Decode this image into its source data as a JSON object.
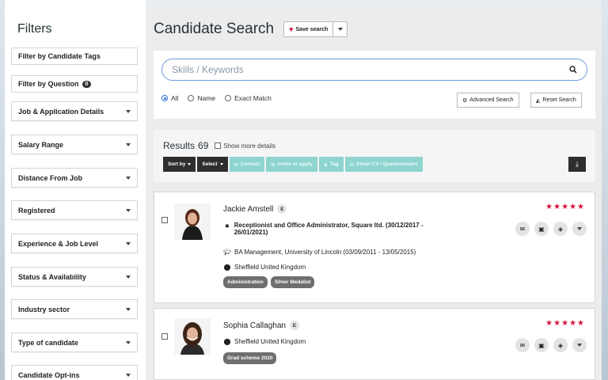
{
  "sidebar": {
    "title": "Filters",
    "tag_filter": "Filter by Candidate Tags",
    "question_filter": "Filter by Question",
    "question_count": "0",
    "dropdowns": [
      "Job & Application Details",
      "Salary Range",
      "Distance From Job",
      "Registered",
      "Experience & Job Level",
      "Status & Availability",
      "Industry sector",
      "Type of candidate",
      "Candidate Opt-ins"
    ]
  },
  "header": {
    "title": "Candidate Search",
    "save_search": "Save search"
  },
  "search": {
    "placeholder": "Skills / Keywords",
    "modes": [
      "All",
      "Name",
      "Exact Match"
    ],
    "selected_mode": "All",
    "advanced_label": "Advanced Search",
    "reset_label": "Reset Search"
  },
  "results": {
    "label": "Results",
    "count": "69",
    "show_more": "Show more details",
    "toolbar": {
      "sort_by": "Sort by",
      "select": "Select",
      "contact": "Contact",
      "invite": "Invite or apply",
      "tag": "Tag",
      "email_cv": "Email CV / Questionnaire"
    }
  },
  "candidates": [
    {
      "name": "Jackie Amstell",
      "badge": "E",
      "role": "Receptionist and Office Administrator, Square ltd. (30/12/2017 - 26/01/2021)",
      "education": "BA Management, University of Lincoln (03/09/2011 - 13/05/2015)",
      "location": "Sheffield United Kingdom",
      "tags": [
        "Administration",
        "Silver Medalist"
      ],
      "stars": "★★★★★"
    },
    {
      "name": "Sophia Callaghan",
      "badge": "E",
      "location": "Sheffield United Kingdom",
      "tags": [
        "Grad scheme 2020"
      ],
      "stars": "★★★★★"
    }
  ],
  "colors": {
    "accent_red": "#d6143c",
    "teal_disabled": "#8ed4cf",
    "dark_button": "#2e2e2e",
    "search_border": "#6d9be0"
  }
}
